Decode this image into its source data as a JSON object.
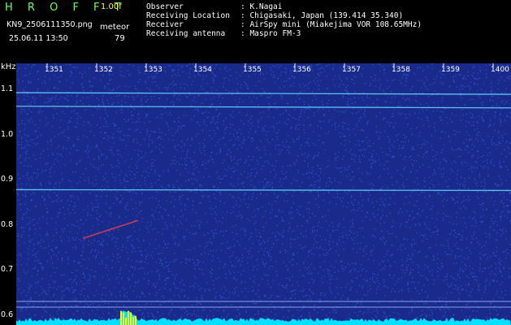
{
  "header": {
    "app_logo": "H R O F F T",
    "version": "1.00f",
    "filename": "KN9_2506111350.png",
    "mode": "meteor",
    "datetime": "25.06.11 13:50",
    "count": "79",
    "info": [
      {
        "label": "Observer",
        "value": ": K.Nagai"
      },
      {
        "label": "Receiving Location",
        "value": ": Chigasaki, Japan (139.414 35.340)"
      },
      {
        "label": "Receiver",
        "value": ": AirSpy mini (Miakejima VOR 108.65MHz)"
      },
      {
        "label": "Receiving antenna",
        "value": ": Maspro FM-3"
      }
    ]
  },
  "chart_data": {
    "type": "heatmap",
    "ylabel": "kHz",
    "x_ticks": [
      "1351",
      "1352",
      "1353",
      "1354",
      "1355",
      "1356",
      "1357",
      "1358",
      "1359",
      "1400"
    ],
    "y_ticks": [
      "1.1",
      "1.0",
      "0.9",
      "0.8",
      "0.7",
      "0.6"
    ],
    "ylim": [
      0.58,
      1.16
    ],
    "carrier_lines_khz": [
      1.095,
      1.065,
      0.88
    ],
    "colors": {
      "background": "#1a2a8a",
      "noise": "#3a6aff",
      "line": "#66ddff",
      "meteor": "#ff4444",
      "baseline": "#00e0ff",
      "peaks": "#ffff00"
    }
  }
}
